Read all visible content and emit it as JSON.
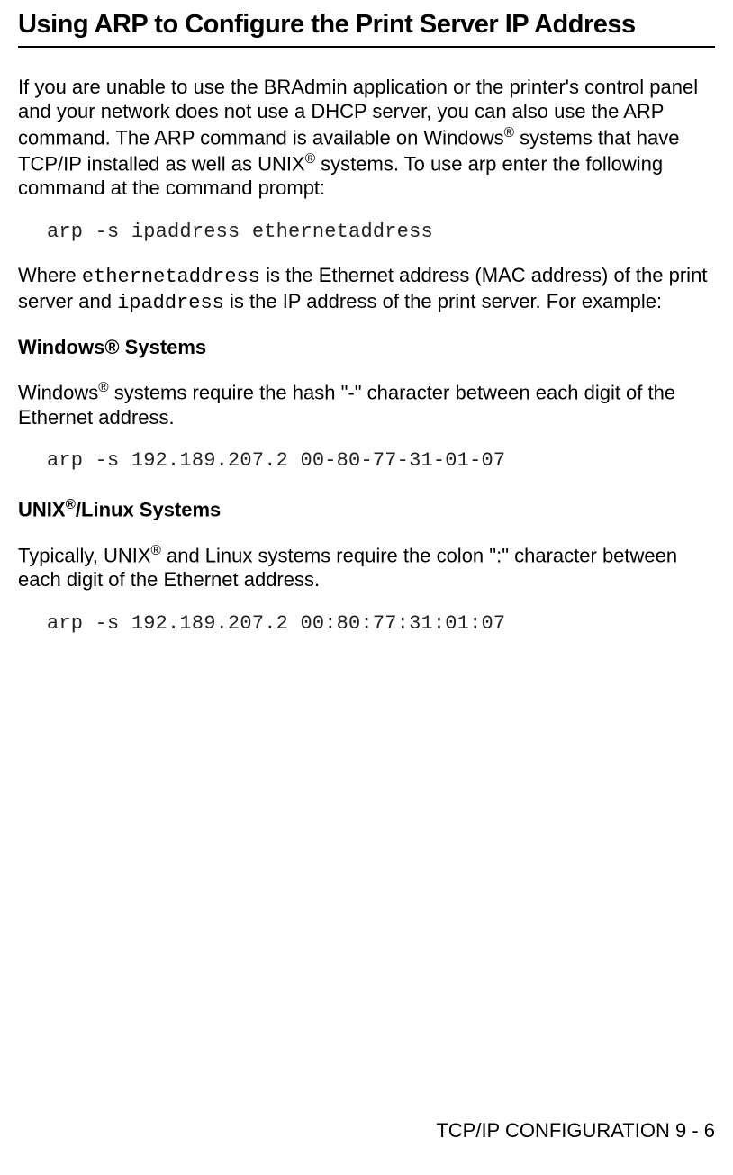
{
  "heading": "Using ARP to Configure the Print Server IP Address",
  "para1_part1": "If you are unable to use the BRAdmin application or the printer's control panel and your network does not use a DHCP server, you can also use the ARP command. The ARP command is available on Windows",
  "para1_reg1": "®",
  "para1_part2": " systems that have TCP/IP installed as well as UNIX",
  "para1_reg2": "®",
  "para1_part3": " systems. To use arp enter the following command at the command prompt:",
  "code1": "arp -s ipaddress ethernetaddress",
  "para2_part1": "Where ",
  "para2_code1": "ethernetaddress",
  "para2_part2": " is the Ethernet address (MAC address) of the print server and ",
  "para2_code2": "ipaddress",
  "para2_part3": " is the IP address of the print server. For example:",
  "sub1": "Windows® Systems",
  "para3_part1": "Windows",
  "para3_reg": "®",
  "para3_part2": " systems require the hash \"-\" character between each digit of the Ethernet address.",
  "code2": "arp -s 192.189.207.2 00-80-77-31-01-07",
  "sub2_part1": "UNIX",
  "sub2_reg": "®",
  "sub2_part2": "/Linux Systems",
  "para4_part1": "Typically, UNIX",
  "para4_reg": "®",
  "para4_part2": " and Linux systems require the colon \":\" character between each digit of the Ethernet address.",
  "code3": "arp -s 192.189.207.2 00:80:77:31:01:07",
  "footer": "TCP/IP CONFIGURATION 9 - 6"
}
